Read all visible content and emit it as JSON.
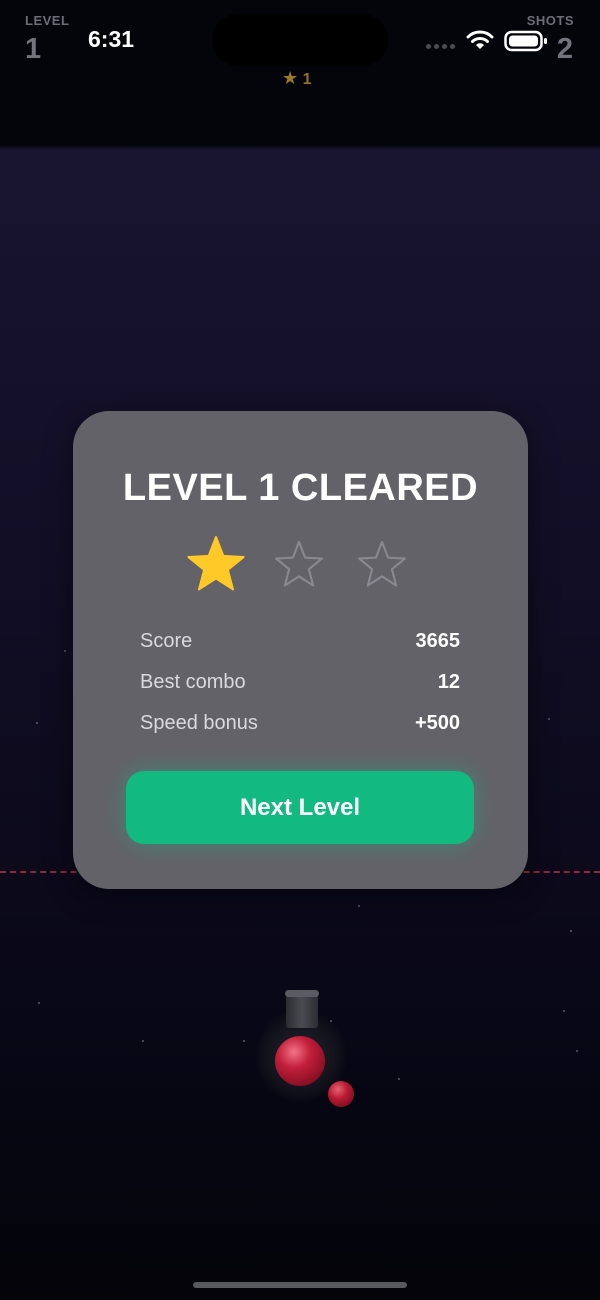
{
  "status_bar": {
    "time": "6:31"
  },
  "hud": {
    "level_label": "LEVEL",
    "level_value": "1",
    "shots_label": "SHOTS",
    "shots_value": "2",
    "stars_collected": "1"
  },
  "dialog": {
    "title": "LEVEL 1 CLEARED",
    "rating": {
      "earned": 1,
      "max": 3
    },
    "stats": [
      {
        "label": "Score",
        "value": "3665"
      },
      {
        "label": "Best combo",
        "value": "12"
      },
      {
        "label": "Speed bonus",
        "value": "+500"
      }
    ],
    "next_button_label": "Next Level"
  },
  "colors": {
    "accent_green": "#12b981",
    "star_filled": "#ffc928",
    "star_empty": "#8a8890",
    "ball_red": "#c21f3a",
    "deadline_red": "#8e2a36"
  },
  "icons": [
    "star-icon",
    "wifi-icon",
    "battery-icon",
    "signal-icon"
  ]
}
